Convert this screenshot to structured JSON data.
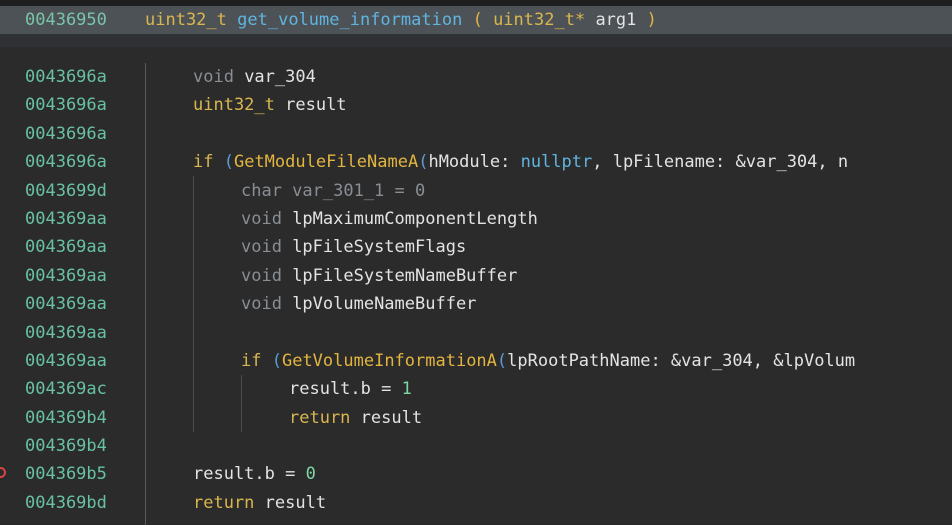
{
  "header": {
    "address": "00436950",
    "ret_type": "uint32_t",
    "func_name": "get_volume_information",
    "param_type": "uint32_t*",
    "param_name": "arg1"
  },
  "lines": [
    {
      "addr": "0043696a",
      "indent": 0,
      "tokens": [
        {
          "c": "kw",
          "t": "void "
        },
        {
          "c": "plain",
          "t": "var_304"
        }
      ]
    },
    {
      "addr": "0043696a",
      "indent": 0,
      "tokens": [
        {
          "c": "type",
          "t": "uint32_t "
        },
        {
          "c": "plain",
          "t": "result"
        }
      ]
    },
    {
      "addr": "0043696a",
      "indent": 0,
      "tokens": []
    },
    {
      "addr": "0043696a",
      "indent": 0,
      "tokens": [
        {
          "c": "kwif",
          "t": "if "
        },
        {
          "c": "paren",
          "t": "("
        },
        {
          "c": "fn",
          "t": "GetModuleFileNameA"
        },
        {
          "c": "paren",
          "t": "("
        },
        {
          "c": "plain",
          "t": "hModule: "
        },
        {
          "c": "lit",
          "t": "nullptr"
        },
        {
          "c": "plain",
          "t": ", lpFilename: &var_304, n"
        }
      ]
    },
    {
      "addr": "0043699d",
      "indent": 1,
      "tokens": [
        {
          "c": "kw",
          "t": "char var_301_1 = 0"
        }
      ]
    },
    {
      "addr": "004369aa",
      "indent": 1,
      "tokens": [
        {
          "c": "kw",
          "t": "void "
        },
        {
          "c": "plain",
          "t": "lpMaximumComponentLength"
        }
      ]
    },
    {
      "addr": "004369aa",
      "indent": 1,
      "tokens": [
        {
          "c": "kw",
          "t": "void "
        },
        {
          "c": "plain",
          "t": "lpFileSystemFlags"
        }
      ]
    },
    {
      "addr": "004369aa",
      "indent": 1,
      "tokens": [
        {
          "c": "kw",
          "t": "void "
        },
        {
          "c": "plain",
          "t": "lpFileSystemNameBuffer"
        }
      ]
    },
    {
      "addr": "004369aa",
      "indent": 1,
      "tokens": [
        {
          "c": "kw",
          "t": "void "
        },
        {
          "c": "plain",
          "t": "lpVolumeNameBuffer"
        }
      ]
    },
    {
      "addr": "004369aa",
      "indent": 1,
      "tokens": []
    },
    {
      "addr": "004369aa",
      "indent": 1,
      "tokens": [
        {
          "c": "kwif",
          "t": "if "
        },
        {
          "c": "paren",
          "t": "("
        },
        {
          "c": "fn",
          "t": "GetVolumeInformationA"
        },
        {
          "c": "paren",
          "t": "("
        },
        {
          "c": "plain",
          "t": "lpRootPathName: &var_304, &lpVolum"
        }
      ]
    },
    {
      "addr": "004369ac",
      "indent": 2,
      "tokens": [
        {
          "c": "plain",
          "t": "result.b = "
        },
        {
          "c": "num",
          "t": "1"
        }
      ]
    },
    {
      "addr": "004369b4",
      "indent": 2,
      "tokens": [
        {
          "c": "ret",
          "t": "return "
        },
        {
          "c": "plain",
          "t": "result"
        }
      ]
    },
    {
      "addr": "004369b4",
      "indent": 0,
      "tokens": []
    },
    {
      "addr": "004369b5",
      "indent": 0,
      "breakpoint": true,
      "tokens": [
        {
          "c": "plain",
          "t": "result.b = "
        },
        {
          "c": "num",
          "t": "0"
        }
      ]
    },
    {
      "addr": "004369bd",
      "indent": 0,
      "tokens": [
        {
          "c": "ret",
          "t": "return "
        },
        {
          "c": "plain",
          "t": "result"
        }
      ]
    }
  ],
  "colors": {
    "background": "#2b2b2b",
    "header_bg": "#4d5257",
    "address": "#68c1a1",
    "type": "#d9b64e",
    "keyword_gray": "#888e93",
    "literal_blue": "#5fb4e0",
    "number_green": "#7fd6a5",
    "breakpoint": "#d64545"
  }
}
